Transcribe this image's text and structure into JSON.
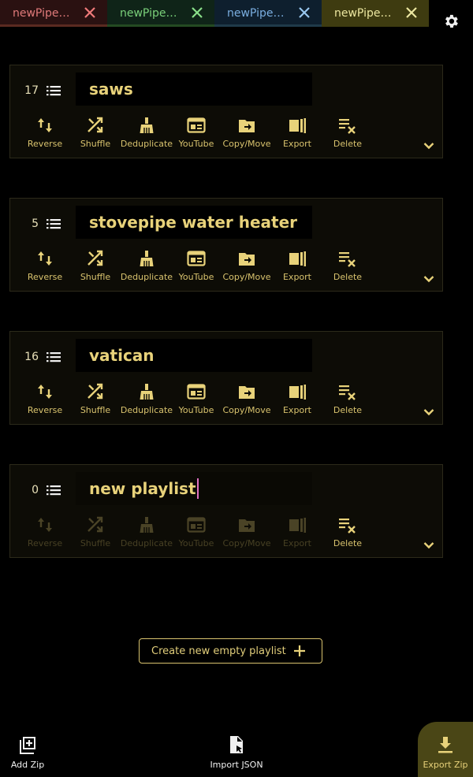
{
  "tabs": [
    {
      "label": "newPipe…",
      "color": "#e07a7a",
      "bg": "#2a1111",
      "underline": "#5a2a20",
      "close_color": "#f07a7a"
    },
    {
      "label": "newPipe…",
      "color": "#7ad07a",
      "bg": "#0f2418",
      "underline": "#244a22",
      "close_color": "#8ae08a"
    },
    {
      "label": "newPipe…",
      "color": "#7aaee0",
      "bg": "#0e1f2e",
      "underline": "#1f3a4a",
      "close_color": "#9ac8f0"
    },
    {
      "label": "newPipe…",
      "color": "#ece7a0",
      "bg": "#3e3b10",
      "underline": "#3e3b10",
      "close_color": "#ece7a0"
    }
  ],
  "playlists": [
    {
      "count": "17",
      "name": "saws"
    },
    {
      "count": "5",
      "name": "stovepipe water heater"
    },
    {
      "count": "16",
      "name": "vatican"
    },
    {
      "count": "0",
      "name": "new playlist"
    }
  ],
  "actions": {
    "reverse": "Reverse",
    "shuffle": "Shuffle",
    "deduplicate": "Deduplicate",
    "youtube": "YouTube",
    "copy_move": "Copy/Move",
    "export": "Export",
    "delete": "Delete"
  },
  "create_button": "Create new empty playlist",
  "bottom_nav": {
    "add_zip": "Add Zip",
    "import_json": "Import JSON",
    "export_zip": "Export Zip"
  },
  "colors": {
    "accent": "#e8d27a",
    "card_bg": "#0d0c06",
    "active_tab_bg": "#3e3b10",
    "export_bg": "#4a4616"
  }
}
